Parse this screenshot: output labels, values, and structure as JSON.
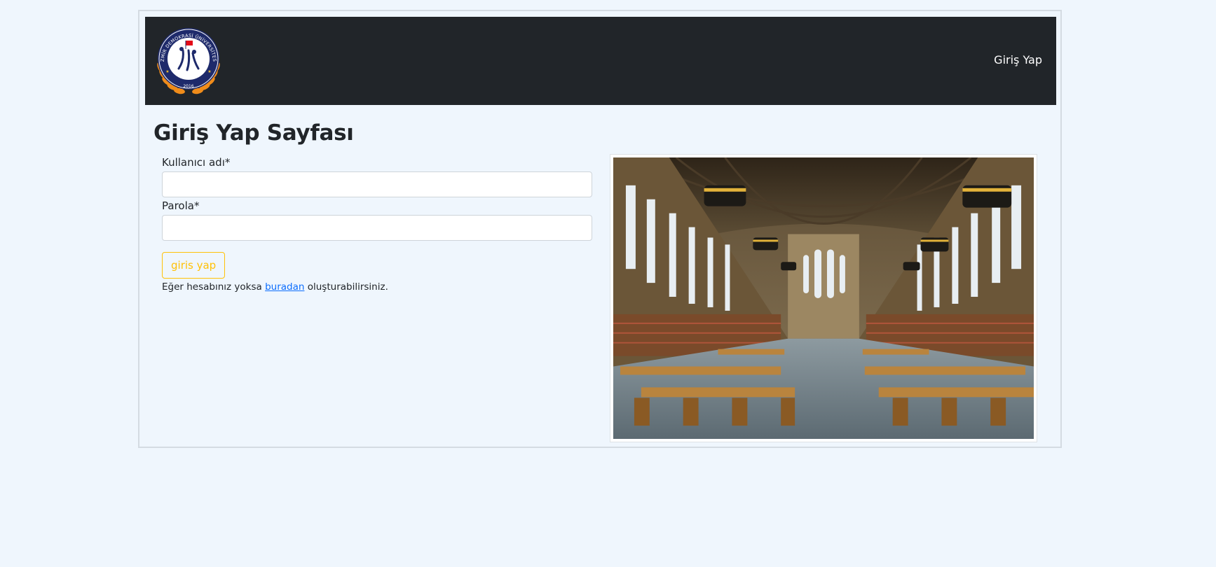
{
  "navbar": {
    "logo_name": "university-seal-logo",
    "logo_text": "İZMİR DEMOKRASİ ÜNİVERSİTESİ",
    "logo_year": "2016",
    "login_link": "Giriş Yap"
  },
  "main": {
    "title": "Giriş Yap Sayfası",
    "username_label": "Kullanıcı adı*",
    "username_value": "",
    "password_label": "Parola*",
    "password_value": "",
    "submit_label": "giris yap",
    "note_before": "Eğer hesabınız yoksa ",
    "note_link": "buradan",
    "note_after": " oluşturabilirsiniz."
  },
  "image": {
    "subject": "library-reading-room-photo"
  },
  "colors": {
    "background": "#eff6fd",
    "navbar": "#212529",
    "button_accent": "#ffc107",
    "link": "#0d6efd"
  }
}
